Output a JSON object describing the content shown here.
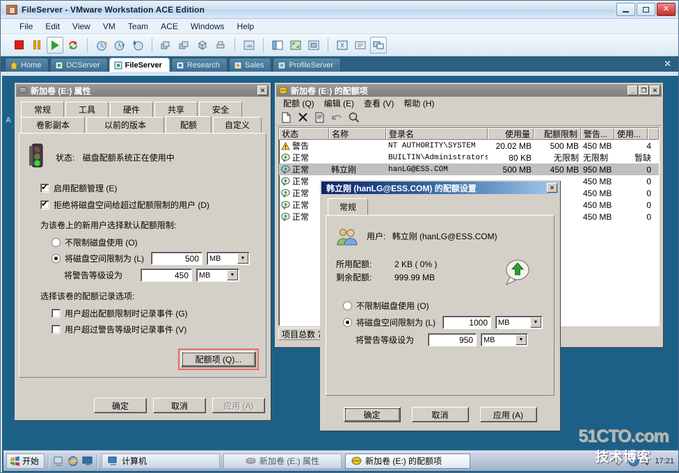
{
  "vmware": {
    "title": "FileServer - VMware Workstation ACE Edition",
    "window_buttons": {
      "minimize": "—",
      "maximize": "❐",
      "close": "✕"
    },
    "menu": [
      "File",
      "Edit",
      "View",
      "VM",
      "Team",
      "ACE",
      "Windows",
      "Help"
    ],
    "toolbar_icons": [
      "stop-icon",
      "pause-icon",
      "play-icon",
      "reset-icon",
      "snapshot-take-icon",
      "snapshot-revert-icon",
      "snapshot-manager-icon",
      "clone-icon",
      "clone-linked-icon",
      "new-vm-icon",
      "remove-icon",
      "capture-screen-icon",
      "show-sidebar-icon",
      "fit-guest-icon",
      "full-screen-icon",
      "settings-icon",
      "summary-icon",
      "multiple-monitors-icon"
    ],
    "tabs": [
      {
        "label": "Home",
        "icon": "home-icon",
        "selected": false
      },
      {
        "label": "DCServer",
        "icon": "vm-icon",
        "selected": false
      },
      {
        "label": "FileServer",
        "icon": "vm-icon",
        "selected": true
      },
      {
        "label": "Research",
        "icon": "vm-icon",
        "selected": false
      },
      {
        "label": "Sales",
        "icon": "vm-icon",
        "selected": false
      },
      {
        "label": "ProfileServer",
        "icon": "vm-icon",
        "selected": false
      }
    ],
    "tabbar_close": "✕",
    "guest_side_letter": "A"
  },
  "properties_dialog": {
    "title": "新加卷 (E:) 属性",
    "title_icon": "volume-icon",
    "close_label": "✕",
    "tabs_row1": [
      "常规",
      "工具",
      "硬件",
      "共享",
      "安全"
    ],
    "tabs_row2": [
      "卷影副本",
      "以前的版本",
      "配额",
      "自定义"
    ],
    "active_tab": "配额",
    "status_icon": "traffic-light-icon",
    "status_label": "状态:",
    "status_text": "磁盘配额系统正在使用中",
    "checkbox_enable": {
      "label": "启用配额管理 (E)",
      "checked": true
    },
    "checkbox_deny": {
      "label": "拒绝将磁盘空间给超过配额限制的用户 (D)",
      "checked": true
    },
    "section_label": "为该卷上的新用户选择默认配额限制:",
    "radio_unlimited": {
      "label": "不限制磁盘使用 (O)",
      "selected": false
    },
    "radio_limit": {
      "label": "将磁盘空间限制为 (L)",
      "selected": true
    },
    "limit_value": "500",
    "limit_unit": "MB",
    "warn_label": "将警告等级设为",
    "warn_value": "450",
    "warn_unit": "MB",
    "log_section_label": "选择该卷的配额记录选项:",
    "checkbox_log_exceed": {
      "label": "用户超出配额限制时记录事件 (G)",
      "checked": false
    },
    "checkbox_log_warn": {
      "label": "用户超过警告等级时记录事件 (V)",
      "checked": false
    },
    "quota_entries_button": "配额项 (Q)...",
    "buttons": {
      "ok": "确定",
      "cancel": "取消",
      "apply": "应用 (A)",
      "apply_disabled": true
    }
  },
  "quota_entries_window": {
    "title": "新加卷 (E:) 的配额项",
    "title_icon": "quota-icon",
    "window_buttons": {
      "minimize": "_",
      "maximize": "❐",
      "close": "✕"
    },
    "menu": [
      "配额 (Q)",
      "编辑 (E)",
      "查看 (V)",
      "帮助 (H)"
    ],
    "toolbar_icons": [
      "new-quota-entry-icon",
      "delete-icon",
      "properties-icon",
      "undo-icon",
      "find-icon"
    ],
    "columns": [
      "状态",
      "名称",
      "登录名",
      "使用量",
      "配额限制",
      "警告...",
      "使用..."
    ],
    "rows": [
      {
        "status": "警告",
        "status_icon": "warning-icon",
        "name": "",
        "login": "NT AUTHORITY\\SYSTEM",
        "used": "20.02 MB",
        "limit": "500 MB",
        "warn": "450 MB",
        "pct": "4",
        "selected": false
      },
      {
        "status": "正常",
        "status_icon": "ok-icon",
        "name": "",
        "login": "BUILTIN\\Administrators",
        "used": "80 KB",
        "limit": "无限制",
        "warn": "无限制",
        "pct": "暂缺",
        "selected": false
      },
      {
        "status": "正常",
        "status_icon": "ok-icon",
        "name": "韩立刚",
        "login": "hanLG@ESS.COM",
        "used": "500 MB",
        "limit": "450 MB",
        "warn": "950 MB",
        "pct": "0",
        "selected": true
      },
      {
        "status": "正常",
        "status_icon": "ok-icon",
        "name": "",
        "login": "",
        "used": "",
        "limit": "",
        "warn": "450 MB",
        "pct": "0",
        "selected": false
      },
      {
        "status": "正常",
        "status_icon": "ok-icon",
        "name": "",
        "login": "",
        "used": "",
        "limit": "",
        "warn": "450 MB",
        "pct": "0",
        "selected": false
      },
      {
        "status": "正常",
        "status_icon": "ok-icon",
        "name": "",
        "login": "",
        "used": "",
        "limit": "",
        "warn": "450 MB",
        "pct": "0",
        "selected": false
      },
      {
        "status": "正常",
        "status_icon": "ok-icon",
        "name": "",
        "login": "",
        "used": "",
        "limit": "",
        "warn": "450 MB",
        "pct": "0",
        "selected": false
      }
    ],
    "status_bar": "项目总数 7"
  },
  "quota_settings_dialog": {
    "title": "韩立刚 (hanLG@ESS.COM) 的配额设置",
    "close_label": "✕",
    "tab": "常规",
    "user_icon": "users-icon",
    "user_label": "用户:",
    "user_value": "韩立刚 (hanLG@ESS.COM)",
    "used_label": "所用配额:",
    "used_value": "2 KB ( 0% )",
    "remaining_label": "剩余配额:",
    "remaining_value": "999.99 MB",
    "gauge_icon": "green-up-arrow-icon",
    "radio_unlimited": {
      "label": "不限制磁盘使用 (O)",
      "selected": false
    },
    "radio_limit": {
      "label": "将磁盘空间限制为 (L)",
      "selected": true
    },
    "limit_value": "1000",
    "limit_unit": "MB",
    "warn_label": "将警告等级设为",
    "warn_value": "950",
    "warn_unit": "MB",
    "buttons": {
      "ok": "确定",
      "cancel": "取消",
      "apply": "应用 (A)"
    }
  },
  "taskbar": {
    "start_label": "开始",
    "start_icon": "windows-flag-icon",
    "quicklaunch": [
      "show-desktop-icon",
      "internet-explorer-icon",
      "monitor-icon"
    ],
    "tasks": [
      {
        "label": "计算机",
        "icon": "computer-icon",
        "active": false
      },
      {
        "label": "新加卷 (E:) 属性",
        "icon": "volume-icon",
        "active": false
      },
      {
        "label": "新加卷 (E:) 的配额项",
        "icon": "quota-icon",
        "active": true
      }
    ],
    "tray": [
      "security-icon",
      "help-icon"
    ],
    "clock": "17:21"
  },
  "watermark": {
    "line1": "51CTO.com",
    "line2": "技术博客"
  }
}
